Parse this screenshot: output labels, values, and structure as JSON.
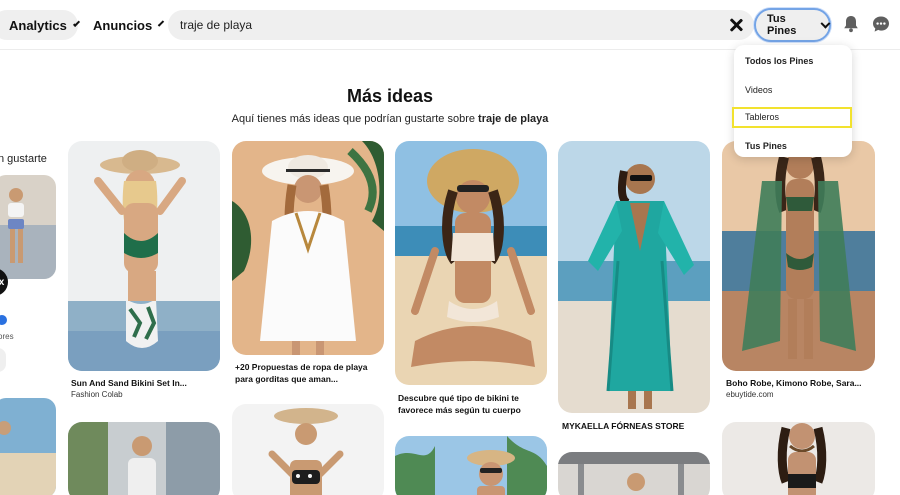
{
  "header": {
    "analytics_label": "Analytics",
    "anuncios_label": "Anuncios",
    "search_value": "traje de playa",
    "scope_label": "Tus Pines"
  },
  "dropdown": {
    "items": [
      "Todos los Pines",
      "Videos",
      "Tableros",
      "Tus Pines"
    ]
  },
  "main": {
    "title": "Más ideas",
    "subtitle_prefix": "Aquí tienes más ideas que podrían gustarte sobre ",
    "subtitle_query": "traje de playa"
  },
  "sidebar": {
    "heading_fragment": "n gustarte",
    "sub_fragment": "ores"
  },
  "pins": [
    {
      "title": "Sun And Sand Bikini Set In...",
      "source": "Fashion Colab"
    },
    {
      "title": "+20 Propuestas de ropa de playa para gorditas que aman...",
      "source": ""
    },
    {
      "title": "Descubre qué tipo de bikini te favorece más según tu cuerpo",
      "source": ""
    },
    {
      "title": "MYKAELLA FÓRNEAS STORE",
      "source": ""
    },
    {
      "title": "Boho Robe, Kimono Robe, Sara...",
      "source": "ebuytide.com"
    }
  ],
  "colors": {
    "focus_ring": "#74a4e6",
    "highlight_box": "#f2e22e",
    "pill_bg": "#efefef"
  }
}
